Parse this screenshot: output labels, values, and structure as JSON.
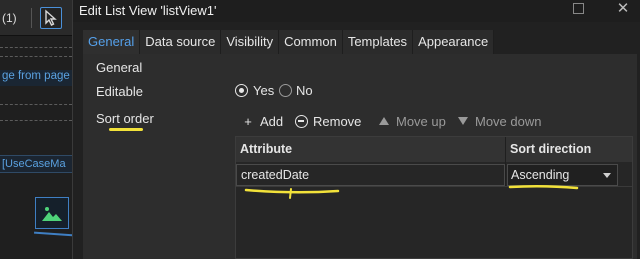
{
  "background": {
    "count_text": "(1)",
    "link_text": "ge from page p",
    "usecase_text": "[UseCaseMa"
  },
  "dialog": {
    "title": "Edit List View 'listView1'",
    "tabs": [
      "General",
      "Data source",
      "Visibility",
      "Common",
      "Templates",
      "Appearance"
    ],
    "active_tab": "General",
    "section_title": "General",
    "editable": {
      "label": "Editable",
      "options": [
        "Yes",
        "No"
      ],
      "selected": "Yes"
    },
    "sort_order": {
      "label": "Sort order",
      "toolbar": {
        "add": "Add",
        "remove": "Remove",
        "move_up": "Move up",
        "move_down": "Move down"
      },
      "columns": [
        "Attribute",
        "Sort direction"
      ],
      "rows": [
        {
          "attribute": "createdDate",
          "direction": "Ascending"
        }
      ]
    }
  },
  "colors": {
    "accent": "#55a0ea",
    "highlight": "#f2e23a",
    "background": "#2d2d2d"
  }
}
